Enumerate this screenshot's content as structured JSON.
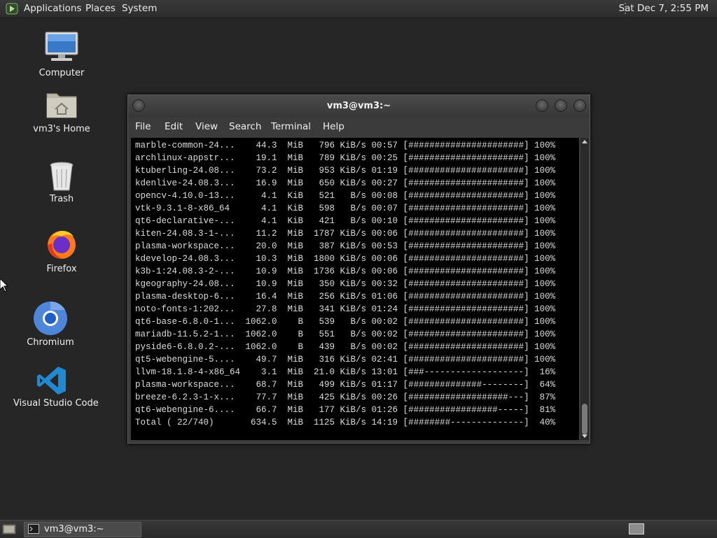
{
  "top_panel": {
    "menus": [
      "Applications",
      "Places",
      "System"
    ],
    "clock": "Sat Dec  7,  2:55 PM"
  },
  "desktop_icons": [
    {
      "label": "Computer",
      "icon": "computer-icon"
    },
    {
      "label": "vm3's Home",
      "icon": "home-folder-icon"
    },
    {
      "label": "Trash",
      "icon": "trash-icon"
    },
    {
      "label": "Firefox",
      "icon": "firefox-icon"
    },
    {
      "label": "Chromium",
      "icon": "chromium-icon"
    },
    {
      "label": "Visual Studio Code",
      "icon": "vscode-icon"
    }
  ],
  "terminal": {
    "title": "vm3@vm3:~",
    "menus": [
      "File",
      "Edit",
      "View",
      "Search",
      "Terminal",
      "Help"
    ],
    "lines": [
      "marble-common-24...    44.3  MiB   796 KiB/s 00:57 [######################] 100%",
      "archlinux-appstr...    19.1  MiB   789 KiB/s 00:25 [######################] 100%",
      "ktuberling-24.08...    73.2  MiB   953 KiB/s 01:19 [######################] 100%",
      "kdenlive-24.08.3...    16.9  MiB   650 KiB/s 00:27 [######################] 100%",
      "opencv-4.10.0-13...     4.1  KiB   521   B/s 00:08 [######################] 100%",
      "vtk-9.3.1-8-x86_64      4.1  KiB   598   B/s 00:07 [######################] 100%",
      "qt6-declarative-...     4.1  KiB   421   B/s 00:10 [######################] 100%",
      "kiten-24.08.3-1-...    11.2  MiB  1787 KiB/s 00:06 [######################] 100%",
      "plasma-workspace...    20.0  MiB   387 KiB/s 00:53 [######################] 100%",
      "kdevelop-24.08.3...    10.3  MiB  1800 KiB/s 00:06 [######################] 100%",
      "k3b-1:24.08.3-2-...    10.9  MiB  1736 KiB/s 00:06 [######################] 100%",
      "kgeography-24.08...    10.9  MiB   350 KiB/s 00:32 [######################] 100%",
      "plasma-desktop-6...    16.4  MiB   256 KiB/s 01:06 [######################] 100%",
      "noto-fonts-1:202...    27.8  MiB   341 KiB/s 01:24 [######################] 100%",
      "qt6-base-6.8.0-1...  1062.0    B   539   B/s 00:02 [######################] 100%",
      "mariadb-11.5.2-1...  1062.0    B   551   B/s 00:02 [######################] 100%",
      "pyside6-6.8.0.2-...  1062.0    B   439   B/s 00:02 [######################] 100%",
      "qt5-webengine-5....    49.7  MiB   316 KiB/s 02:41 [######################] 100%",
      "llvm-18.1.8-4-x86_64    3.1  MiB  21.0 KiB/s 13:01 [###-------------------]  16%",
      "plasma-workspace...    68.7  MiB   499 KiB/s 01:17 [##############--------]  64%",
      "breeze-6.2.3-1-x...    77.7  MiB   425 KiB/s 00:26 [###################---]  87%",
      "qt6-webengine-6....    66.7  MiB   177 KiB/s 01:26 [#################-----]  81%",
      "Total ( 22/740)       634.5  MiB  1125 KiB/s 14:19 [########--------------]  40%"
    ]
  },
  "taskbar": {
    "window_button": "vm3@vm3:~"
  }
}
